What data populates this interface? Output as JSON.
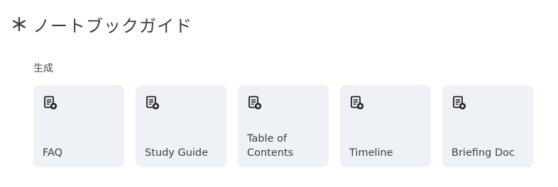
{
  "header": {
    "icon": "asterisk-icon",
    "title": "ノートブックガイド"
  },
  "generate": {
    "label": "生成",
    "cards": [
      {
        "icon": "note-add-icon",
        "label": "FAQ"
      },
      {
        "icon": "note-add-icon",
        "label": "Study Guide"
      },
      {
        "icon": "note-add-icon",
        "label": "Table of\nContents"
      },
      {
        "icon": "note-add-icon",
        "label": "Timeline"
      },
      {
        "icon": "note-add-icon",
        "label": "Briefing Doc"
      }
    ]
  },
  "colors": {
    "card_background": "#eef1f6",
    "text": "#3c4043",
    "icon": "#1f1f1f"
  }
}
